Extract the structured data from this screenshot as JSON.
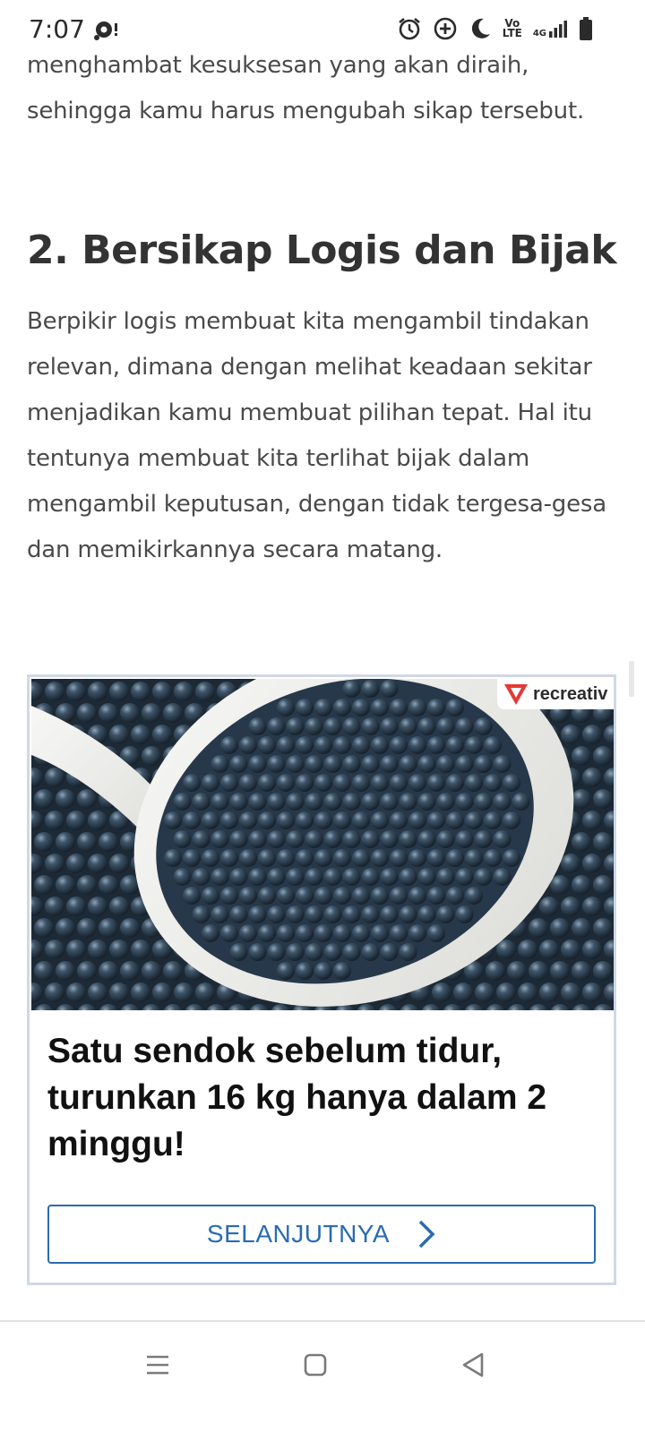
{
  "status_bar": {
    "time": "7:07",
    "network_label_top": "Vo",
    "network_label_bottom": "LTE",
    "signal_label": "4G",
    "icons": [
      "notification-icon",
      "alarm-icon",
      "data-saver-icon",
      "do-not-disturb-moon-icon",
      "volte-icon",
      "signal-4g-icon",
      "battery-icon"
    ]
  },
  "article": {
    "paragraph_top": "menghambat kesuksesan yang akan diraih, sehingga kamu harus mengubah sikap tersebut.",
    "heading": "2. Bersikap Logis dan Bijak",
    "paragraph_main": "Berpikir logis membuat kita mengambil tindakan relevan, dimana dengan melihat keadaan sekitar menjadikan kamu membuat pilihan tepat. Hal itu tentunya membuat kita terlihat bijak dalam mengambil keputusan, dengan tidak tergesa-gesa dan memikirkannya secara matang."
  },
  "ad": {
    "badge_label": "recreativ",
    "image_subject": "spoon of dark tapioca pearls",
    "title": "Satu sendok sebelum tidur, turunkan 16 kg hanya dalam 2 minggu!",
    "button_label": "SELANJUTNYA",
    "colors": {
      "accent": "#2a6bb0",
      "badge_red": "#e53935",
      "border": "#d0d8e6"
    }
  },
  "nav_bar": {
    "items": [
      "menu-icon",
      "home-square-icon",
      "back-triangle-icon"
    ]
  }
}
